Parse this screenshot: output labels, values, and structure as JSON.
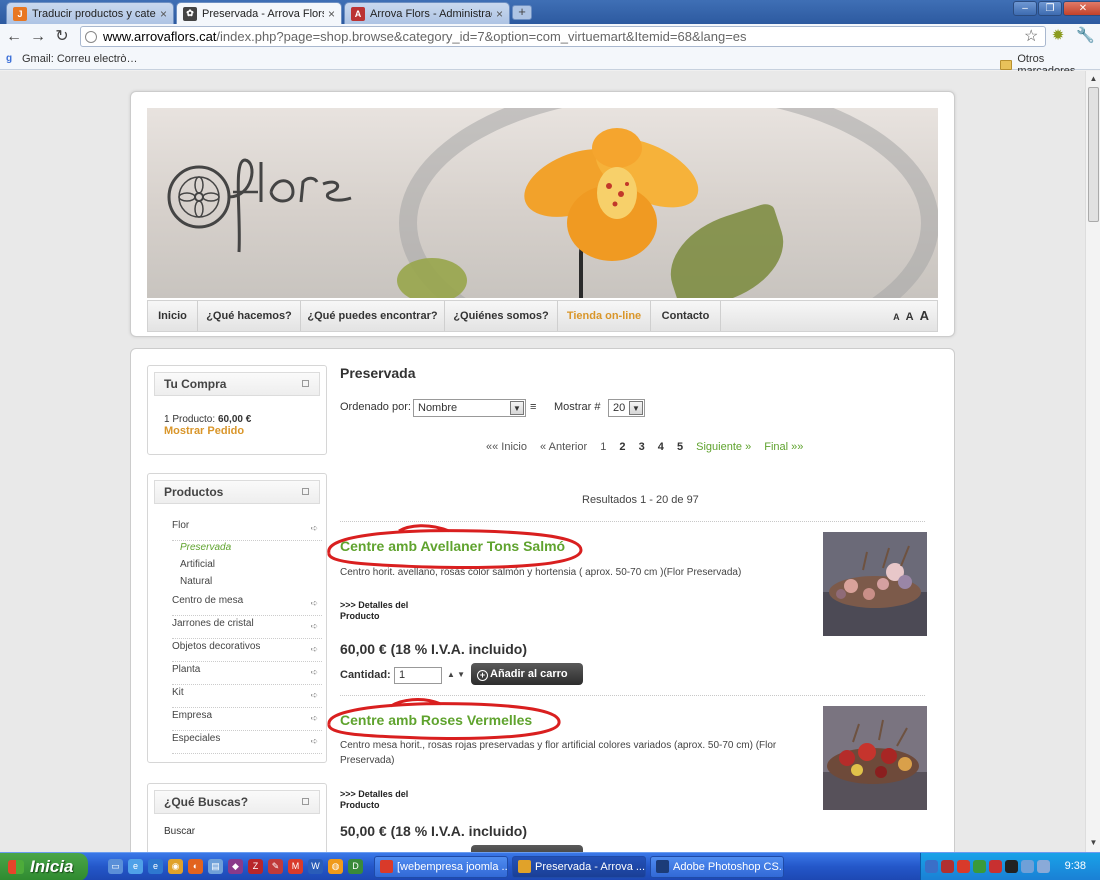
{
  "browser": {
    "tabs": [
      {
        "title": "Traducir productos y categ…",
        "active": false
      },
      {
        "title": "Preservada - Arrova Flors",
        "active": true
      },
      {
        "title": "Arrova Flors - Administración",
        "active": false
      }
    ],
    "url_host": "www.arrovaflors.cat",
    "url_rest": "/index.php?page=shop.browse&category_id=7&option=com_virtuemart&Itemid=68&lang=es",
    "bookmarks": {
      "gmail": "Gmail: Correu electrò…",
      "other": "Otros marcadores"
    }
  },
  "site": {
    "menu": [
      "Inicio",
      "¿Qué hacemos?",
      "¿Qué puedes encontrar?",
      "¿Quiénes somos?",
      "Tienda on-line",
      "Contacto"
    ],
    "active_menu_index": 4,
    "font_controls": [
      "A",
      "A",
      "A"
    ]
  },
  "sidebar": {
    "cart": {
      "title": "Tu Compra",
      "summary_label": "1 Producto:",
      "summary_value": "60,00 €",
      "show_link": "Mostrar Pedido"
    },
    "products": {
      "title": "Productos",
      "flor": "Flor",
      "subcategories": [
        "Preservada",
        "Artificial",
        "Natural"
      ],
      "categories": [
        "Centro de mesa",
        "Jarrones de cristal",
        "Objetos decorativos",
        "Planta",
        "Kit",
        "Empresa",
        "Especiales"
      ]
    },
    "search": {
      "title": "¿Qué Buscas?",
      "label": "Buscar"
    }
  },
  "main": {
    "title": "Preservada",
    "sort_label": "Ordenado por:",
    "sort_value": "Nombre",
    "show_label": "Mostrar #",
    "show_value": "20",
    "pagination": {
      "first": "«« Inicio",
      "prev": "« Anterior",
      "pages": [
        "1",
        "2",
        "3",
        "4",
        "5"
      ],
      "next": "Siguiente »",
      "last": "Final »»"
    },
    "results": "Resultados 1 - 20 de 97",
    "products": [
      {
        "title": "Centre amb Avellaner Tons Salmó",
        "description": "Centro horit. avellano, rosas color salmón y hortensia ( aprox. 50-70 cm )(Flor Preservada)",
        "details": ">>> Detalles del Producto",
        "price": "60,00 € (18 % I.V.A. incluido)",
        "qty_label": "Cantidad:",
        "qty": "1",
        "add_to_cart": "Añadir al carro"
      },
      {
        "title": "Centre amb Roses Vermelles",
        "description": "Centro mesa horit., rosas rojas preservadas y flor artificial colores variados (aprox. 50-70 cm) (Flor Preservada)",
        "details": ">>> Detalles del Producto",
        "price": "50,00 € (18 % I.V.A. incluido)"
      }
    ]
  },
  "taskbar": {
    "start": "Inicia",
    "tasks": [
      "[webempresa joomla ...",
      "Preservada - Arrova ...",
      "Adobe Photoshop CS..."
    ],
    "clock": "9:38"
  },
  "colors": {
    "accent_green": "#5fa32e",
    "accent_orange": "#d9962a",
    "annotation_red": "#d91f1f"
  }
}
